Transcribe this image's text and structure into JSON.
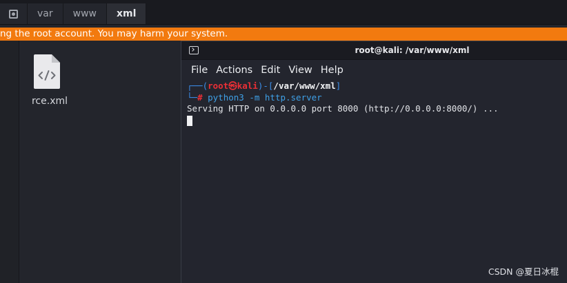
{
  "file_manager": {
    "breadcrumb": [
      {
        "label": ""
      },
      {
        "label": "var"
      },
      {
        "label": "www"
      },
      {
        "label": "xml"
      }
    ],
    "warning_text": "ng the root account. You may harm your system.",
    "files": [
      {
        "name": "rce.xml",
        "icon": "xml-file-icon"
      }
    ]
  },
  "terminal": {
    "title": "root@kali: /var/www/xml",
    "menu": [
      "File",
      "Actions",
      "Edit",
      "View",
      "Help"
    ],
    "prompt": {
      "corner_top": "┌──(",
      "user": "root",
      "skull": "㉿",
      "host": "kali",
      "sep": ")-[",
      "path": "/var/www/xml",
      "close": "]",
      "corner_bottom": "└─",
      "hash": "#"
    },
    "command": "python3 -m http.server",
    "output": "Serving HTTP on 0.0.0.0 port 8000 (http://0.0.0.0:8000/) ..."
  },
  "watermark": "CSDN @夏日冰棍",
  "colors": {
    "warning_bar": "#f27a0f",
    "prompt_red": "#ea2f36",
    "prompt_blue": "#3b8eea"
  }
}
